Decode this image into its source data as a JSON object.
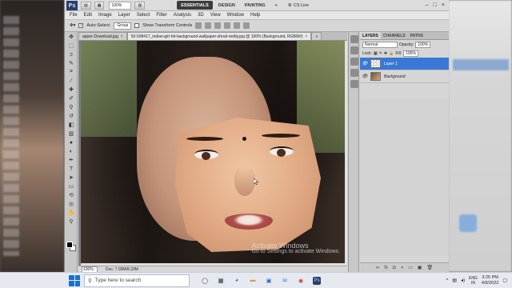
{
  "titlebar": {
    "logo": "Ps",
    "zoom": "100%",
    "workspaces": [
      "ESSENTIALS",
      "DESIGN",
      "PAINTING"
    ],
    "active_workspace": "ESSENTIALS",
    "more": "»",
    "cs_live": "CS Live",
    "window_controls": [
      "–",
      "□",
      "×"
    ]
  },
  "menubar": [
    "File",
    "Edit",
    "Image",
    "Layer",
    "Select",
    "Filter",
    "Analysis",
    "3D",
    "View",
    "Window",
    "Help"
  ],
  "options": {
    "auto_select_label": "Auto-Select:",
    "auto_select_value": "Group",
    "show_transform": "Show Transform Controls"
  },
  "document": {
    "tabs": [
      {
        "label": "apper-Download.jpg",
        "active": false
      },
      {
        "label": "50-508417_indian-girl-hd-background-wallpaper-shruti-reddy.jpg @ 100% (Background, RGB/8#)",
        "active": true
      }
    ],
    "tab_close": "×",
    "overflow": "»",
    "zoom": "100%",
    "doc_size": "Doc: 7.03M/8.33M",
    "watermark_title": "Activate Windows",
    "watermark_sub": "Go to Settings to activate Windows."
  },
  "layers_panel": {
    "tabs": [
      "LAYERS",
      "CHANNELS",
      "PATHS"
    ],
    "blend_mode": "Normal",
    "opacity_label": "Opacity:",
    "opacity_value": "100%",
    "lock_label": "Lock:",
    "fill_label": "Fill:",
    "fill_value": "100%",
    "layers": [
      {
        "name": "Layer 1",
        "selected": true
      },
      {
        "name": "Background",
        "selected": false
      }
    ]
  },
  "taskbar": {
    "search_placeholder": "Type here to search",
    "lang": "ENG",
    "lang_sub": "IN",
    "time": "3:25 PM",
    "date": "4/9/2022"
  },
  "colors": {
    "accent": "#3a78d6",
    "start": "#1a6fd0"
  }
}
